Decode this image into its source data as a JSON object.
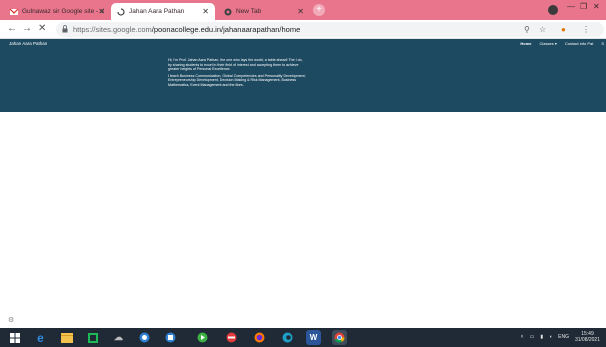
{
  "browser": {
    "tabs": [
      {
        "title": "Gulnawaz sir Google site - sheet",
        "active": false
      },
      {
        "title": "Jahan Aara Pathan",
        "active": true
      },
      {
        "title": "New Tab",
        "active": false
      }
    ],
    "url_host": "https://sites.google.com",
    "url_path": "/poonacollege.edu.in/jahanaarapathan/home",
    "colors": {
      "titlebar": "#e8758b",
      "site_bg": "#1e4a61",
      "taskbar": "#1f2a36"
    }
  },
  "site": {
    "title": "Jahan Aara Pathan",
    "nav": [
      "Home",
      "Classes ▾",
      "Contact info Pat",
      "S"
    ],
    "paragraph1": "Hi, I'm Prof. Jahan Aara Pathan, the one who lays the world, a table ahead! The I do, by sharing students to excel in their field of interest and accepting them to achieve greater heights of Personal Excellence.",
    "paragraph2": "I teach Business Communication, Global Competencies and Personality Development, Entrepreneurship Development, Decision Making & Risk Management, Business Mathematics, Event Management and the likes."
  },
  "taskbar": {
    "apps": [
      "windows",
      "edge",
      "file-explorer",
      "store",
      "weather",
      "chrome-alt",
      "calculator",
      "media",
      "photos",
      "firefox",
      "edge-new",
      "word",
      "chrome"
    ],
    "lang": "ENG",
    "time": "15:49",
    "date": "31/08/2021"
  }
}
